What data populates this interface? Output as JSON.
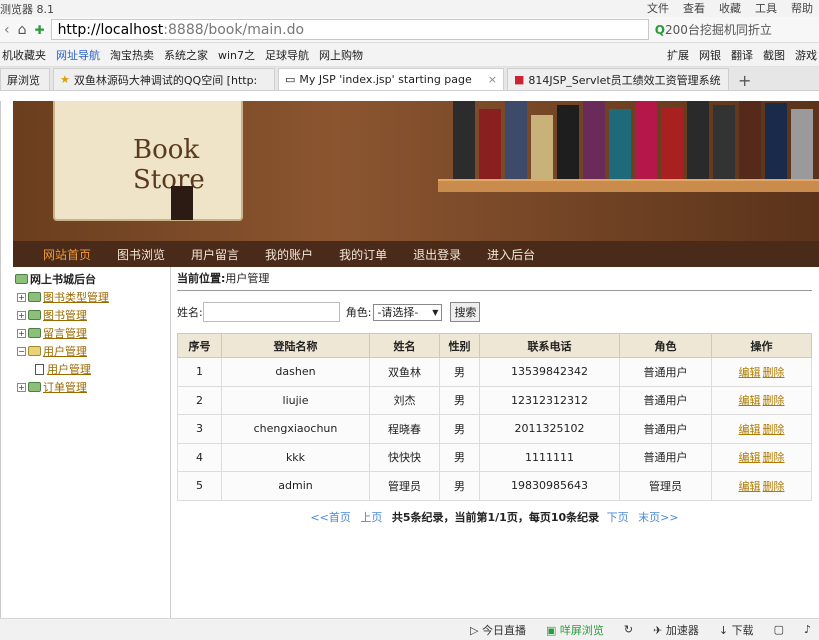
{
  "browser": {
    "title": "测览器 8.1",
    "menus": [
      "文件",
      "查看",
      "收藏",
      "工具",
      "帮助"
    ],
    "url_host": "http://localhost",
    "url_rest": ":8888/book/main.do",
    "search_hint": "200台挖掘机同折立"
  },
  "bookmarks": [
    "机收藏夹",
    "网址导航",
    "淘宝热卖",
    "系统之家",
    "win7之",
    "足球导航",
    "网上购物",
    "扩展",
    "网银",
    "翻译",
    "截图",
    "游戏"
  ],
  "tabs": [
    "屏浏览",
    "双鱼林源码大神调试的QQ空间 [http:",
    "My JSP 'index.jsp' starting page",
    "814JSP_Servlet员工绩效工资管理系统"
  ],
  "banner": {
    "title": "Book Store"
  },
  "nav": [
    "网站首页",
    "图书浏览",
    "用户留言",
    "我的账户",
    "我的订单",
    "退出登录",
    "进入后台"
  ],
  "tree": {
    "root": "网上书城后台",
    "items": [
      "图书类型管理",
      "图书管理",
      "留言管理",
      "用户管理",
      "用户管理",
      "订单管理"
    ]
  },
  "crumb": {
    "label": "当前位置:",
    "value": "用户管理"
  },
  "search": {
    "name_label": "姓名:",
    "name_value": "",
    "role_label": "角色:",
    "role_selected": "-请选择-",
    "button": "搜索"
  },
  "table": {
    "headers": [
      "序号",
      "登陆名称",
      "姓名",
      "性别",
      "联系电话",
      "角色",
      "操作"
    ],
    "rows": [
      [
        "1",
        "dashen",
        "双鱼林",
        "男",
        "13539842342",
        "普通用户"
      ],
      [
        "2",
        "liujie",
        "刘杰",
        "男",
        "12312312312",
        "普通用户"
      ],
      [
        "3",
        "chengxiaochun",
        "程晓春",
        "男",
        "2011325102",
        "普通用户"
      ],
      [
        "4",
        "kkk",
        "快快快",
        "男",
        "1111111",
        "普通用户"
      ],
      [
        "5",
        "admin",
        "管理员",
        "男",
        "19830985643",
        "管理员"
      ]
    ],
    "edit": "编辑",
    "delete": "删除"
  },
  "pager": {
    "first": "<<首页",
    "prev": "上页",
    "info": "共5条纪录，当前第1/1页，每页10条纪录",
    "next": "下页",
    "last": "末页>>"
  },
  "status": [
    "今日直播",
    "咩屏浏览",
    "加速器",
    "下载"
  ],
  "colors": {
    "nav_bg": "#4a2a18",
    "nav_active": "#f39a3a",
    "link": "#4a8ad8",
    "op_link": "#b07b00"
  }
}
